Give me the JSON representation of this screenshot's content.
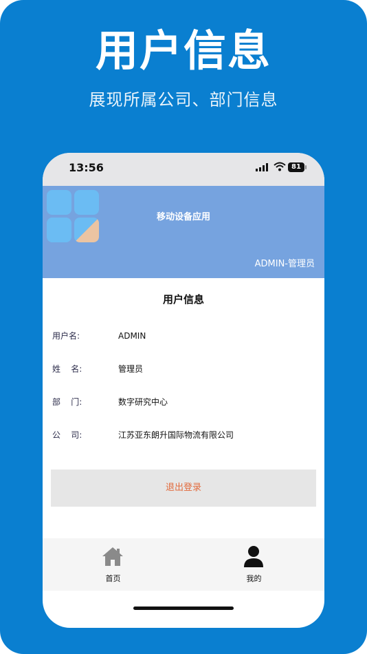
{
  "hero": {
    "title": "用户信息",
    "subtitle": "展现所属公司、部门信息"
  },
  "status_bar": {
    "time": "13:56",
    "battery": "81"
  },
  "app": {
    "title": "移动设备应用",
    "user_role": "ADMIN-管理员"
  },
  "user_info": {
    "section_title": "用户信息",
    "fields": [
      {
        "label": "用户名:",
        "value": "ADMIN"
      },
      {
        "label": "姓    名:",
        "value": "管理员"
      },
      {
        "label": "部    门:",
        "value": "数字研究中心"
      },
      {
        "label": "公    司:",
        "value": "江苏亚东朗升国际物流有限公司"
      }
    ]
  },
  "logout": {
    "label": "退出登录"
  },
  "tabbar": {
    "items": [
      {
        "label": "首页",
        "icon": "home-icon"
      },
      {
        "label": "我的",
        "icon": "user-icon"
      }
    ]
  },
  "colors": {
    "background": "#0a7fd0",
    "header": "#76a3df",
    "logout_text": "#e26a3c"
  }
}
